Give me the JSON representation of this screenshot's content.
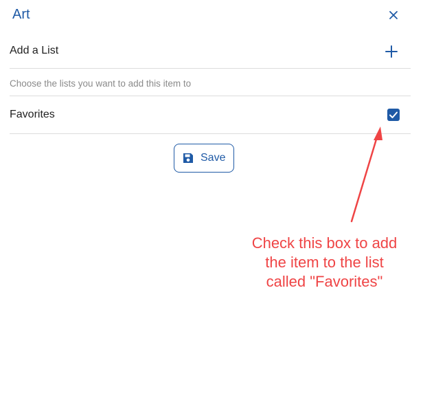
{
  "dialog": {
    "title": "Art",
    "close_icon": "close-icon",
    "add_list_label": "Add a List",
    "add_icon": "plus-icon",
    "hint": "Choose the lists you want to add this item to",
    "lists": [
      {
        "label": "Favorites",
        "checked": true
      }
    ],
    "save_label": "Save",
    "save_icon": "floppy-disk-icon"
  },
  "annotation": {
    "lines": [
      "Check this box to add",
      "the item to the list",
      "called \"Favorites\""
    ],
    "color": "#ef4445"
  },
  "colors": {
    "accent": "#1f5aa6",
    "divider": "#dcdcdc",
    "hint_text": "#8a8a8a"
  }
}
